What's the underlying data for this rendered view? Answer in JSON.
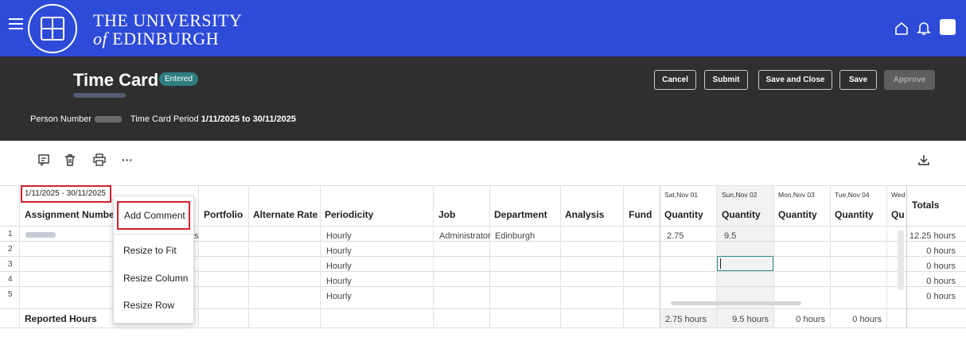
{
  "brand": {
    "line1": "THE UNIVERSITY",
    "line2_prefix": "of",
    "line2_rest": "EDINBURGH"
  },
  "icons": {
    "menu": "hamburger-icon",
    "home": "home-icon",
    "notifications": "bell-icon",
    "comments": "comment-icon",
    "delete": "delete-icon",
    "print": "print-icon",
    "more": "more-icon",
    "download": "download-icon"
  },
  "header": {
    "title": "Time Card",
    "status_badge": "Entered",
    "person_number_label": "Person Number",
    "period_label": "Time Card Period",
    "period_value": "1/11/2025 to 30/11/2025",
    "buttons": {
      "cancel": "Cancel",
      "submit": "Submit",
      "save_close": "Save and Close",
      "save": "Save",
      "approve": "Approve"
    }
  },
  "toolbar": {
    "more_label": "···",
    "download_label": "⤓"
  },
  "grid": {
    "period_range": "1/11/2025 - 30/11/2025",
    "columns": {
      "assignment": "Assignment Number",
      "portfolio": "Portfolio",
      "alternate_rate": "Alternate Rate",
      "periodicity": "Periodicity",
      "job": "Job",
      "department": "Department",
      "analysis": "Analysis",
      "fund": "Fund",
      "quantity": "Quantity",
      "quantity_partial": "Qu",
      "totals": "Totals"
    },
    "dates": [
      "Sat,Nov 01",
      "Sun,Nov 02",
      "Mon,Nov 03",
      "Tue,Nov 04",
      "Wed"
    ],
    "rows": [
      {
        "num": "1",
        "portfolio_frag": "s",
        "periodicity": "Hourly",
        "job": "Administrator",
        "department": "Edinburgh",
        "sat": "2.75",
        "sun": "9.5",
        "total": "12.25 hours"
      },
      {
        "num": "2",
        "periodicity": "Hourly",
        "total": "0 hours"
      },
      {
        "num": "3",
        "periodicity": "Hourly",
        "total": "0 hours"
      },
      {
        "num": "4",
        "periodicity": "Hourly",
        "total": "0 hours"
      },
      {
        "num": "5",
        "periodicity": "Hourly",
        "total": "0 hours"
      }
    ],
    "reported": {
      "label": "Reported Hours",
      "sat": "2.75 hours",
      "sun": "9.5 hours",
      "mon": "0 hours",
      "tue": "0 hours"
    }
  },
  "context_menu": {
    "items": [
      "Add Comment",
      "Resize to Fit",
      "Resize Column",
      "Resize Row"
    ]
  }
}
